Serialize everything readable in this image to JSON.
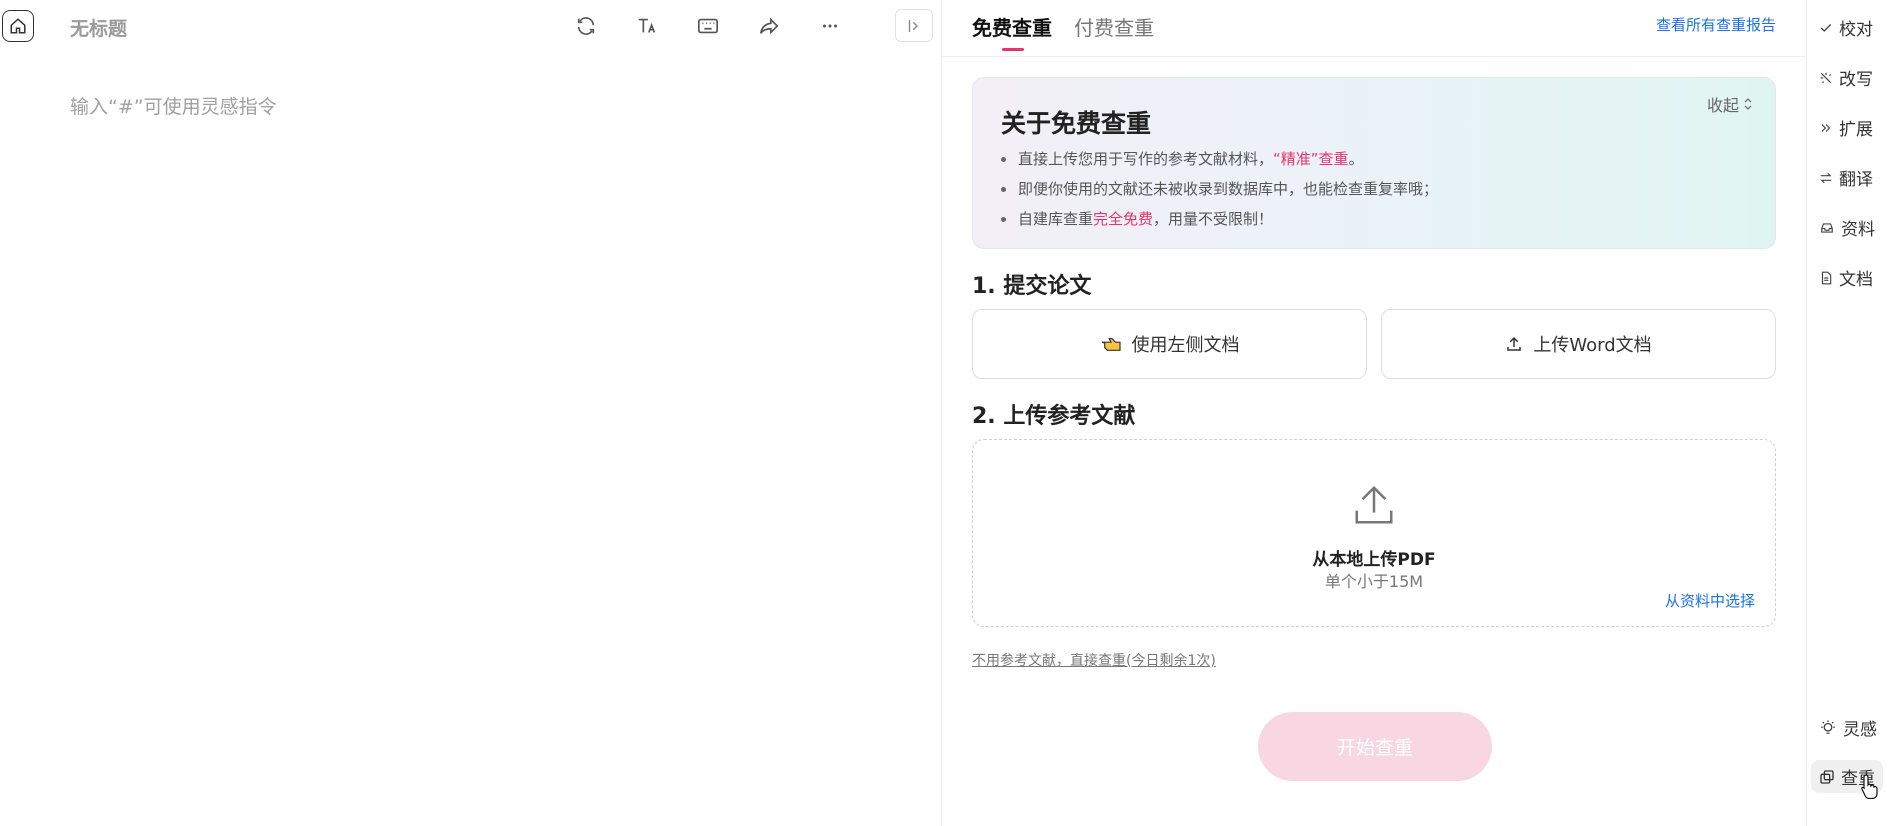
{
  "editor": {
    "title": "无标题",
    "placeholder": "输入“#”可使用灵感指令"
  },
  "panel": {
    "tabs": [
      {
        "label": "免费查重",
        "active": true
      },
      {
        "label": "付费查重",
        "active": false
      }
    ],
    "all_reports_link": "查看所有查重报告",
    "info": {
      "title": "关于免费查重",
      "collapse_label": "收起",
      "items": [
        {
          "pre": "直接上传您用于写作的参考文献材料，",
          "highlight": "“精准”查重",
          "post": "。"
        },
        {
          "pre": "即便你使用的文献还未被收录到数据库中，也能检查重复率哦；",
          "highlight": "",
          "post": ""
        },
        {
          "pre": "自建库查重",
          "highlight": "完全免费",
          "post": "，用量不受限制！"
        }
      ]
    },
    "step1": {
      "title": "1. 提交论文",
      "use_left_doc": "使用左侧文档",
      "upload_word": "上传Word文档"
    },
    "step2": {
      "title": "2. 上传参考文献",
      "upload_main": "从本地上传PDF",
      "upload_sub": "单个小于15M",
      "from_library": "从资料中选择"
    },
    "skip_link": "不用参考文献，直接查重(今日剩余1次)",
    "start_button": "开始查重"
  },
  "sidebar": {
    "items": [
      {
        "label": "校对",
        "icon": "check-icon"
      },
      {
        "label": "改写",
        "icon": "sparkle-icon"
      },
      {
        "label": "扩展",
        "icon": "double-chevron-icon"
      },
      {
        "label": "翻译",
        "icon": "swap-icon"
      },
      {
        "label": "资料",
        "icon": "inbox-icon"
      },
      {
        "label": "文档",
        "icon": "file-icon"
      }
    ],
    "bottom_items": [
      {
        "label": "灵感",
        "icon": "bulb-icon"
      },
      {
        "label": "查重",
        "icon": "copy-icon",
        "active": true
      }
    ]
  },
  "colors": {
    "accent": "#e7336a",
    "link": "#1a73e8",
    "start_button_bg": "#f9d7e2"
  }
}
